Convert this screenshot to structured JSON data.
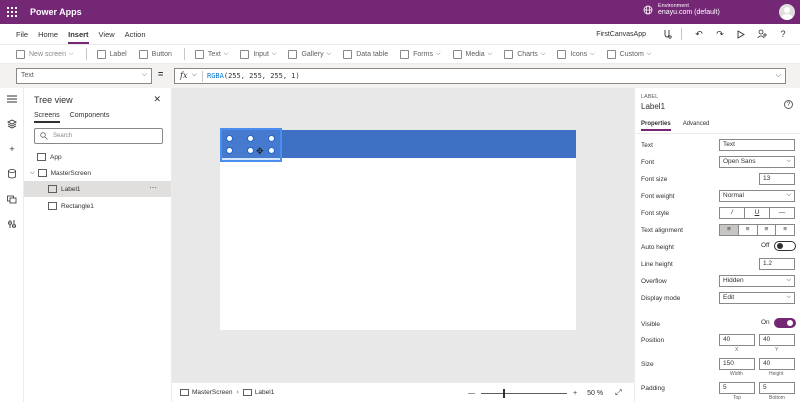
{
  "app": {
    "title": "Power Apps",
    "env_caption": "Environment",
    "env_name": "enayu.com (default)"
  },
  "menu": {
    "items": [
      "File",
      "Home",
      "Insert",
      "View",
      "Action"
    ],
    "active": "Insert",
    "project_name": "FirstCanvasApp"
  },
  "ribbon": {
    "new_screen": "New screen",
    "label": "Label",
    "button": "Button",
    "text": "Text",
    "input": "Input",
    "gallery": "Gallery",
    "data_table": "Data table",
    "forms": "Forms",
    "media": "Media",
    "charts": "Charts",
    "icons": "Icons",
    "custom": "Custom"
  },
  "formula": {
    "property": "Text",
    "fn": "RGBA",
    "args": "(255, 255, 255, 1)"
  },
  "tree": {
    "title": "Tree view",
    "tabs": [
      "Screens",
      "Components"
    ],
    "search_placeholder": "Search",
    "items": {
      "app": "App",
      "screen": "MasterScreen",
      "label": "Label1",
      "rect": "Rectangle1"
    },
    "more": "···"
  },
  "status": {
    "screen": "MasterScreen",
    "control": "Label1",
    "zoom": "50",
    "zoom_unit": "%"
  },
  "props": {
    "caption": "LABEL",
    "name": "Label1",
    "tabs": [
      "Properties",
      "Advanced"
    ],
    "rows": {
      "text": {
        "label": "Text",
        "value": "Text"
      },
      "font": {
        "label": "Font",
        "value": "Open Sans"
      },
      "font_size": {
        "label": "Font size",
        "value": "13"
      },
      "font_weight": {
        "label": "Font weight",
        "value": "Normal"
      },
      "font_style": {
        "label": "Font style",
        "italic": "/",
        "underline": "U",
        "strike": "—"
      },
      "text_alignment": {
        "label": "Text alignment"
      },
      "auto_height": {
        "label": "Auto height",
        "value": "Off"
      },
      "line_height": {
        "label": "Line height",
        "value": "1.2"
      },
      "overflow": {
        "label": "Overflow",
        "value": "Hidden"
      },
      "display_mode": {
        "label": "Display mode",
        "value": "Edit"
      },
      "visible": {
        "label": "Visible",
        "value": "On"
      },
      "position": {
        "label": "Position",
        "x": "40",
        "y": "40",
        "x_cap": "X",
        "y_cap": "Y"
      },
      "size": {
        "label": "Size",
        "w": "150",
        "h": "40",
        "w_cap": "Width",
        "h_cap": "Height"
      },
      "padding": {
        "label": "Padding",
        "top": "5",
        "bottom": "5",
        "top_cap": "Top",
        "bottom_cap": "Bottom"
      }
    }
  },
  "colors": {
    "brand": "#742774",
    "band": "#3e70c3",
    "selection": "#4a8ff0"
  }
}
